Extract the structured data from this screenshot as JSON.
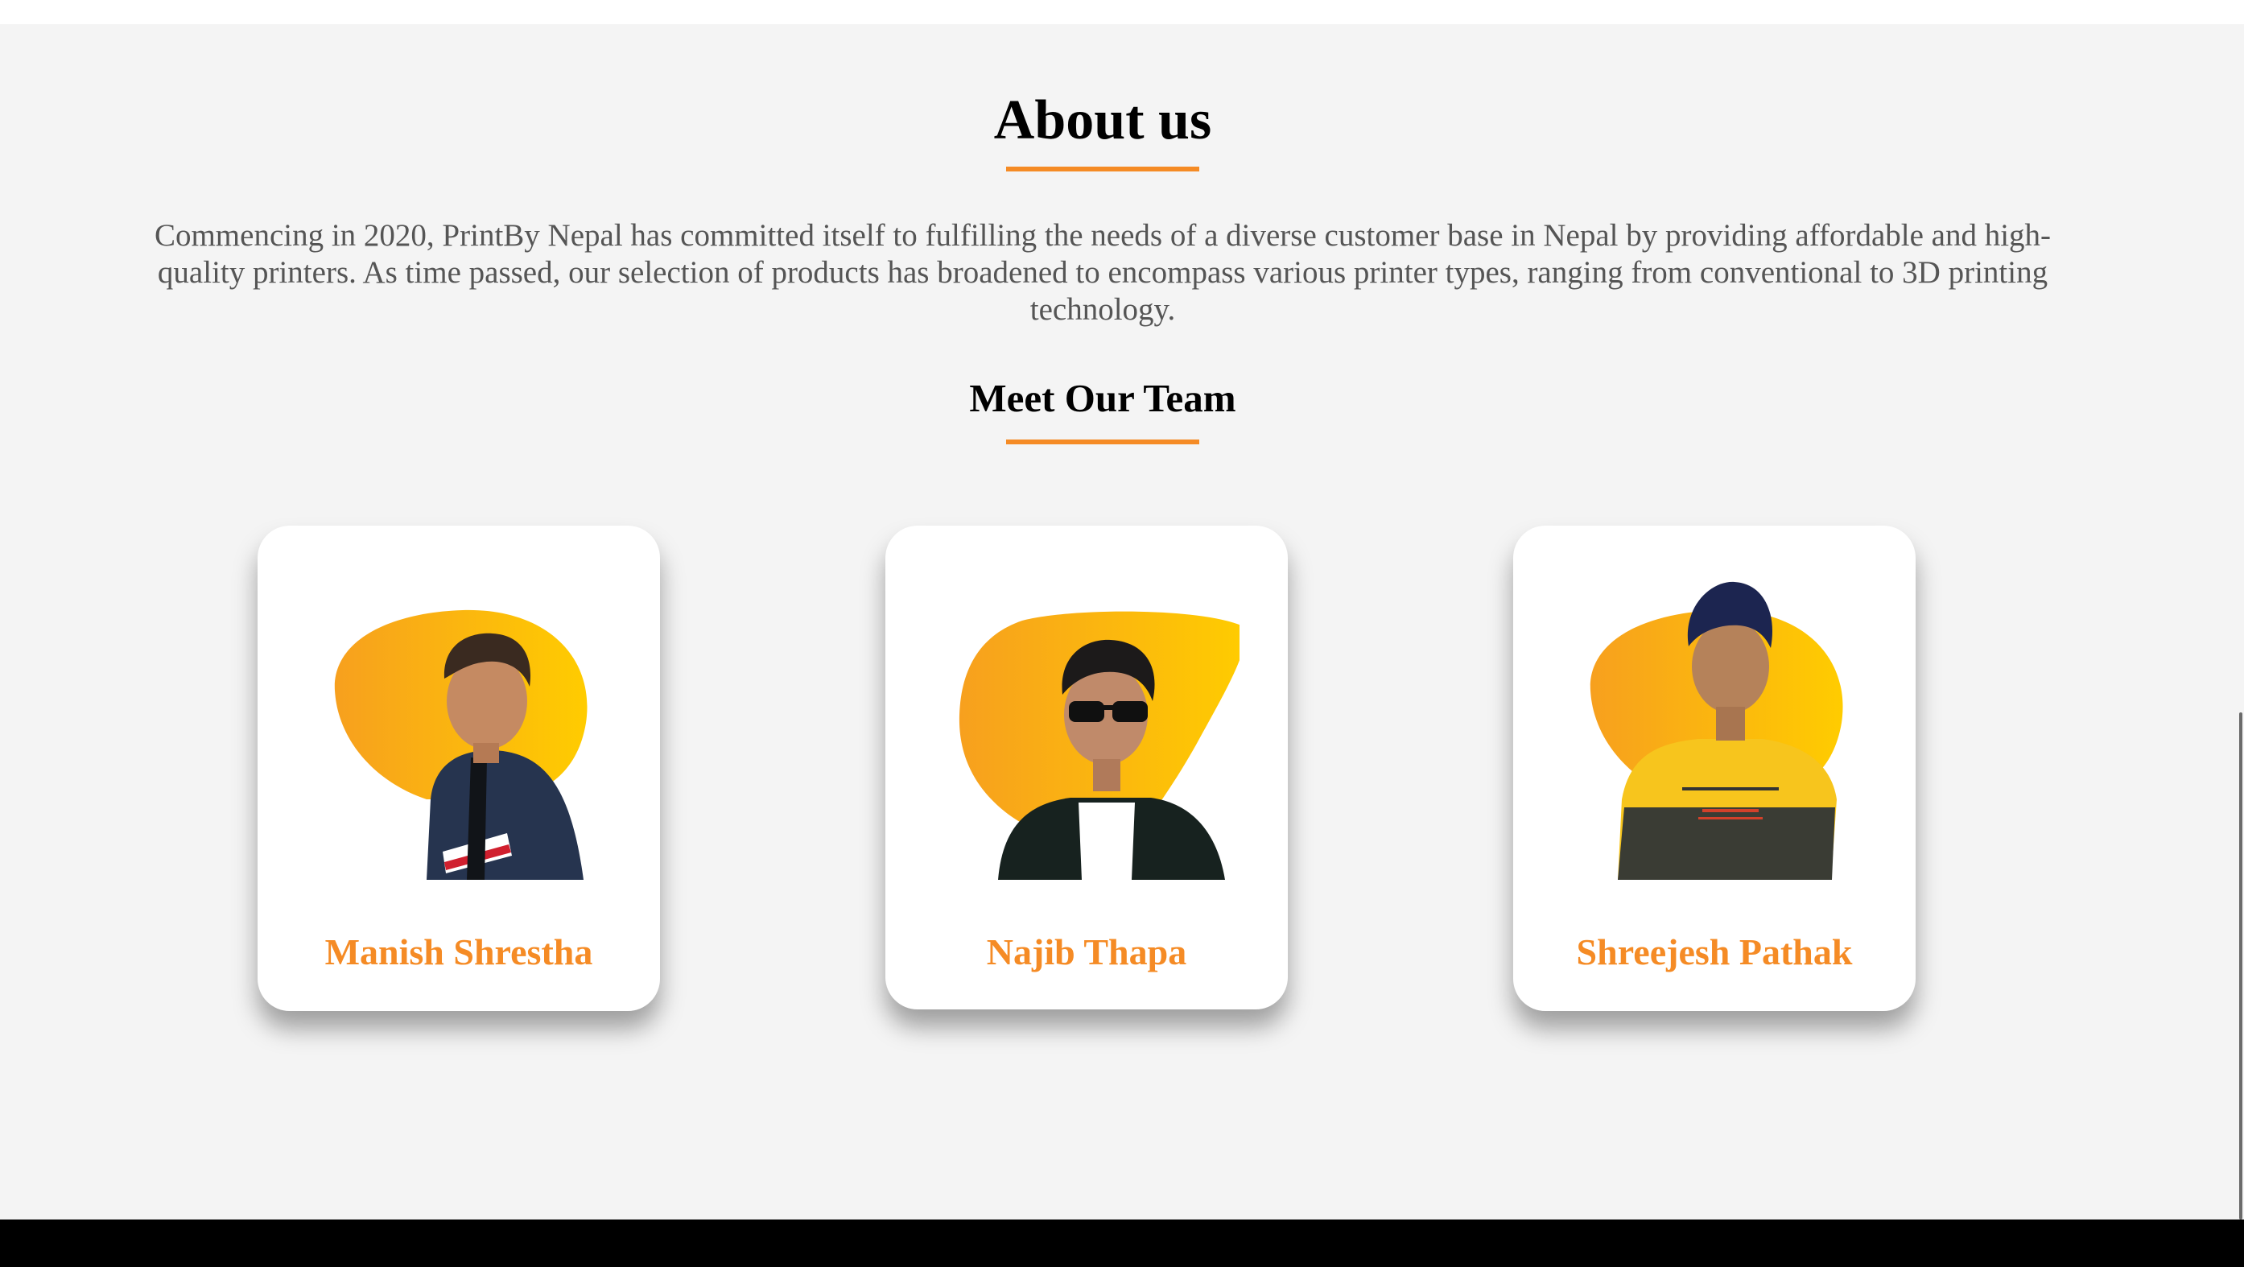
{
  "about": {
    "title": "About us",
    "description": "Commencing in 2020, PrintBy Nepal has committed itself to fulfilling the needs of a diverse customer base in Nepal by providing affordable and high-quality printers. As time passed, our selection of products has broadened to encompass various printer types, ranging from conventional to 3D printing technology."
  },
  "team": {
    "title": "Meet Our Team",
    "members": [
      {
        "name": "Manish Shrestha",
        "portrait": "photo-person-jacket"
      },
      {
        "name": "Najib Thapa",
        "portrait": "photo-person-sunglasses-blazer"
      },
      {
        "name": "Shreejesh Pathak",
        "portrait": "photo-person-yellow-sweater"
      }
    ]
  },
  "colors": {
    "accent": "#f58b25",
    "blob_start": "#f7a01e",
    "blob_end": "#ffcc00",
    "background": "#f4f4f4",
    "footer": "#000000",
    "text_muted": "#555555"
  }
}
